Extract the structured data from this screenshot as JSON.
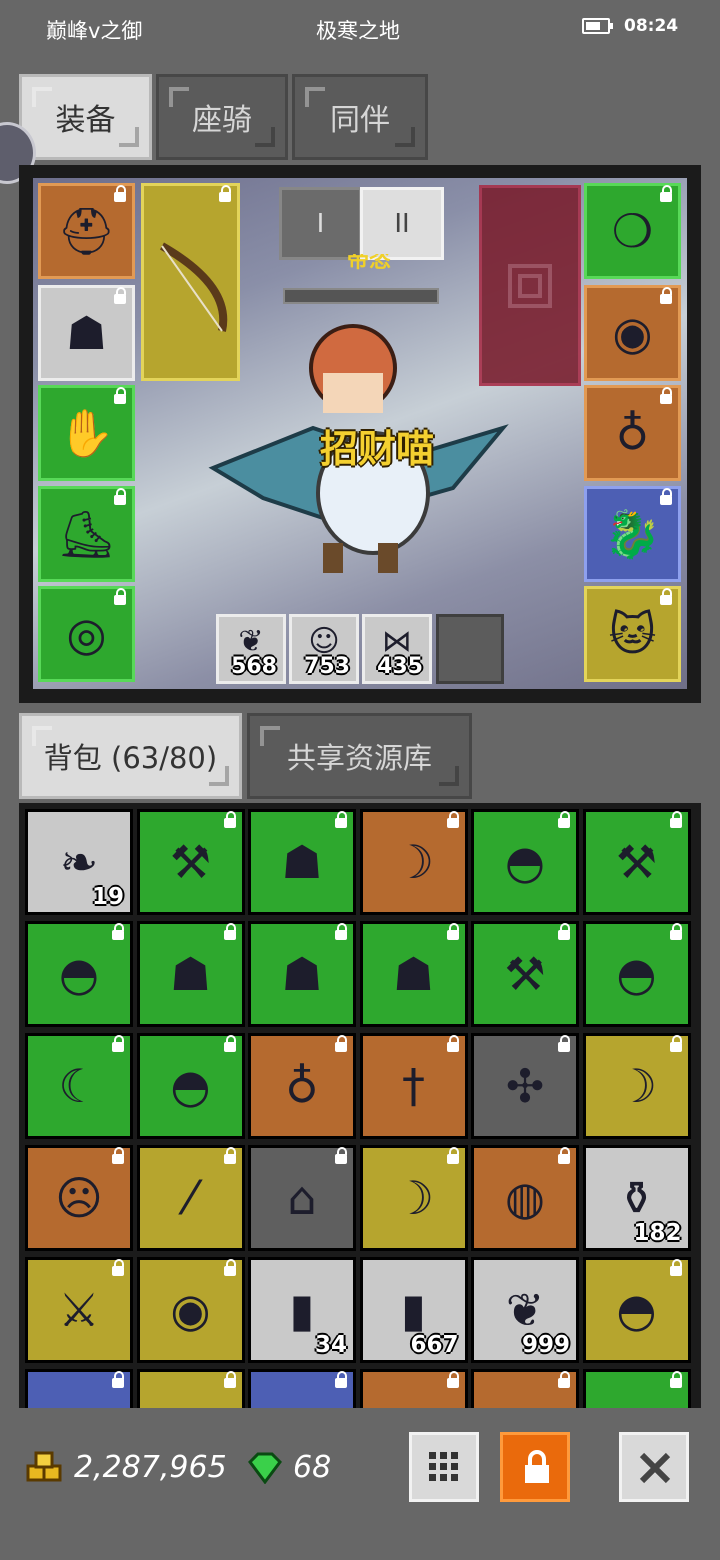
{
  "status_bar": {
    "player": "巅峰v之御",
    "zone": "极寒之地",
    "time": "08:24"
  },
  "tabs": [
    {
      "label": "装备",
      "active": true
    },
    {
      "label": "座骑",
      "active": false
    },
    {
      "label": "同伴",
      "active": false
    }
  ],
  "equip_page_tabs": [
    {
      "label": "I"
    },
    {
      "label": "II",
      "active": true
    }
  ],
  "scene": {
    "title_partial": "帝恣",
    "companion_name": "招财喵"
  },
  "left_slots": [
    {
      "icon": "red-hat-icon",
      "rarity": "orange"
    },
    {
      "icon": "dark-armor-icon",
      "rarity": "grey"
    },
    {
      "icon": "blue-gauntlet-icon",
      "rarity": "green"
    },
    {
      "icon": "brown-boots-icon",
      "rarity": "green"
    },
    {
      "icon": "blue-belt-icon",
      "rarity": "green"
    }
  ],
  "weapon_slot": {
    "icon": "bow-icon",
    "rarity": "yellow"
  },
  "right_slots": [
    {
      "icon": "purple-necklace-icon",
      "rarity": "green"
    },
    {
      "icon": "gold-ruby-ring-icon",
      "rarity": "orange"
    },
    {
      "icon": "gold-earring-icon",
      "rarity": "orange"
    },
    {
      "icon": "raptor-mount-icon",
      "rarity": "blue"
    },
    {
      "icon": "cat-companion-icon",
      "rarity": "yellow"
    }
  ],
  "consumables": [
    {
      "icon": "red-leaf-icon",
      "count": "568"
    },
    {
      "icon": "chef-icon",
      "count": "753"
    },
    {
      "icon": "fish-icon",
      "count": "435"
    }
  ],
  "bag_tabs": [
    {
      "label": "背包 (63/80)",
      "active": true
    },
    {
      "label": "共享资源库",
      "active": false
    }
  ],
  "bag_rows": [
    [
      {
        "icon": "blue-feather-icon",
        "rarity": "grey",
        "count": "19"
      },
      {
        "icon": "mace-icon",
        "rarity": "green"
      },
      {
        "icon": "dark-armor-icon",
        "rarity": "green"
      },
      {
        "icon": "red-bow-icon",
        "rarity": "orange"
      },
      {
        "icon": "dark-helmet-icon",
        "rarity": "green"
      },
      {
        "icon": "mace-icon",
        "rarity": "green"
      }
    ],
    [
      {
        "icon": "dark-helmet-icon",
        "rarity": "green"
      },
      {
        "icon": "dark-armor-icon",
        "rarity": "green"
      },
      {
        "icon": "dark-armor-icon",
        "rarity": "green"
      },
      {
        "icon": "dark-armor-icon",
        "rarity": "green"
      },
      {
        "icon": "mace-icon",
        "rarity": "green"
      },
      {
        "icon": "dark-helmet-icon",
        "rarity": "green"
      }
    ],
    [
      {
        "icon": "scythe-icon",
        "rarity": "green"
      },
      {
        "icon": "dark-helmet-icon",
        "rarity": "green"
      },
      {
        "icon": "gold-earring-icon",
        "rarity": "orange"
      },
      {
        "icon": "gold-dagger-icon",
        "rarity": "orange"
      },
      {
        "icon": "crossbow-icon",
        "rarity": "dgrey"
      },
      {
        "icon": "bow-icon",
        "rarity": "yellow"
      }
    ],
    [
      {
        "icon": "demon-mask-icon",
        "rarity": "orange"
      },
      {
        "icon": "wooden-club-icon",
        "rarity": "yellow"
      },
      {
        "icon": "house-icon",
        "rarity": "dgrey"
      },
      {
        "icon": "bow-icon",
        "rarity": "yellow"
      },
      {
        "icon": "basket-icon",
        "rarity": "orange"
      },
      {
        "icon": "red-potion-icon",
        "rarity": "grey",
        "count": "182"
      }
    ],
    [
      {
        "icon": "crossed-swords-icon",
        "rarity": "yellow"
      },
      {
        "icon": "ruby-amulet-icon",
        "rarity": "yellow"
      },
      {
        "icon": "red-vial-icon",
        "rarity": "grey",
        "count": "34"
      },
      {
        "icon": "blue-vial-icon",
        "rarity": "grey",
        "count": "667"
      },
      {
        "icon": "red-leaf-icon",
        "rarity": "grey",
        "count": "999"
      },
      {
        "icon": "leather-hood-icon",
        "rarity": "yellow"
      }
    ],
    [
      {
        "icon": "item-icon",
        "rarity": "blue"
      },
      {
        "icon": "item-icon",
        "rarity": "yellow"
      },
      {
        "icon": "item-icon",
        "rarity": "blue"
      },
      {
        "icon": "item-icon",
        "rarity": "orange"
      },
      {
        "icon": "item-icon",
        "rarity": "orange"
      },
      {
        "icon": "item-icon",
        "rarity": "green"
      }
    ]
  ],
  "currency": {
    "gold": "2,287,965",
    "gems": "68"
  },
  "toolbar": [
    {
      "icon": "grid-icon",
      "name": "grid-view-button"
    },
    {
      "icon": "lock-icon",
      "name": "lock-button"
    },
    {
      "icon": "close-icon",
      "name": "close-button"
    }
  ]
}
